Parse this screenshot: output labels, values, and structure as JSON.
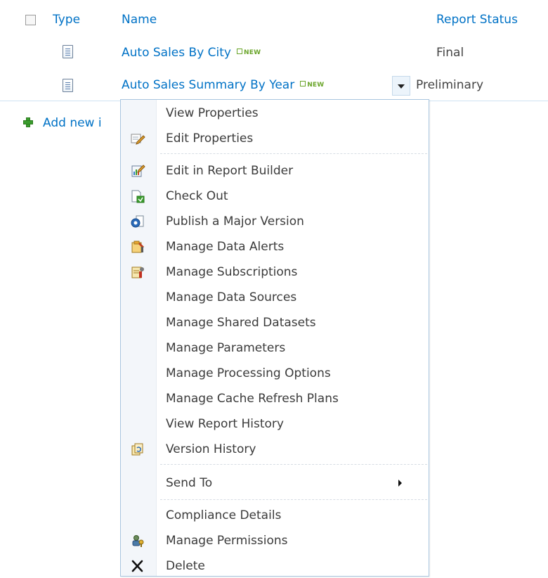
{
  "columns": {
    "type": "Type",
    "name": "Name",
    "status": "Report Status"
  },
  "rows": [
    {
      "name": "Auto Sales By City",
      "badge": "NEW",
      "status": "Final"
    },
    {
      "name": "Auto Sales Summary By Year",
      "badge": "NEW",
      "status": "Preliminary"
    }
  ],
  "add_new_label": "Add new i",
  "menu": {
    "items": [
      {
        "label": "View Properties",
        "icon": "none"
      },
      {
        "label": "Edit Properties",
        "icon": "edit-properties-icon"
      },
      {
        "label": "Edit in Report Builder",
        "icon": "report-builder-icon"
      },
      {
        "label": "Check Out",
        "icon": "check-out-icon"
      },
      {
        "label": "Publish a Major Version",
        "icon": "publish-icon"
      },
      {
        "label": "Manage Data Alerts",
        "icon": "data-alerts-icon"
      },
      {
        "label": "Manage Subscriptions",
        "icon": "subscriptions-icon"
      },
      {
        "label": "Manage Data Sources",
        "icon": "none"
      },
      {
        "label": "Manage Shared Datasets",
        "icon": "none"
      },
      {
        "label": "Manage Parameters",
        "icon": "none"
      },
      {
        "label": "Manage Processing Options",
        "icon": "none"
      },
      {
        "label": "Manage Cache Refresh Plans",
        "icon": "none"
      },
      {
        "label": "View Report History",
        "icon": "none"
      },
      {
        "label": "Version History",
        "icon": "version-history-icon"
      },
      {
        "label": "Send To",
        "icon": "none",
        "submenu": true
      },
      {
        "label": "Compliance Details",
        "icon": "none"
      },
      {
        "label": "Manage Permissions",
        "icon": "permissions-icon"
      },
      {
        "label": "Delete",
        "icon": "delete-icon"
      }
    ]
  },
  "colors": {
    "link": "#0072c6",
    "new_badge": "#6aa52a",
    "menu_border": "#a9c6e0"
  }
}
